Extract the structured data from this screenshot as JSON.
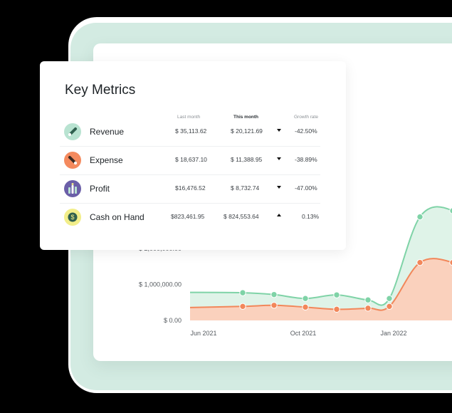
{
  "metrics": {
    "title": "Key Metrics",
    "columns": {
      "last_month": "Last month",
      "this_month": "This month",
      "growth": "Growth rate"
    },
    "rows": [
      {
        "label": "Revenue",
        "last": "$ 35,113.62",
        "this": "$ 20,121.69",
        "direction": "down",
        "growth": "-42.50%",
        "icon": "revenue-icon",
        "icon_color": "#b8e3d1"
      },
      {
        "label": "Expense",
        "last": "$ 18,637.10",
        "this": "$ 11,388.95",
        "direction": "down",
        "growth": "-38.89%",
        "icon": "expense-icon",
        "icon_color": "#f48a5e"
      },
      {
        "label": "Profit",
        "last": "$16,476.52",
        "this": "$ 8,732.74",
        "direction": "down",
        "growth": "-47.00%",
        "icon": "profit-icon",
        "icon_color": "#6b5fa8"
      },
      {
        "label": "Cash on Hand",
        "last": "$823,461.95",
        "this": "$ 824,553.64",
        "direction": "up",
        "growth": "0.13%",
        "icon": "cash-icon",
        "icon_color": "#f2ee8a"
      }
    ]
  },
  "chart_data": {
    "type": "area",
    "y_ticks": [
      "$ 0.00",
      "$ 1,000,000.00",
      "$ 2,000,000.00"
    ],
    "ylim": [
      0,
      3000000
    ],
    "x_ticks": [
      "Jun 2021",
      "Oct 2021",
      "Jan 2022"
    ],
    "x": [
      0,
      1,
      2,
      3,
      4,
      5,
      6,
      7,
      8,
      9
    ],
    "series": [
      {
        "color": "#7fd3a7",
        "fill": "#dff3e8",
        "values": [
          780000,
          770000,
          720000,
          610000,
          710000,
          570000,
          610000,
          2880000,
          3050000,
          2200000
        ]
      },
      {
        "color": "#f2875a",
        "fill": "#fad1bd",
        "values": [
          360000,
          390000,
          420000,
          370000,
          310000,
          340000,
          390000,
          1610000,
          1610000,
          1140000
        ]
      }
    ],
    "colors": {
      "green_line": "#7fd3a7",
      "orange_line": "#f2875a"
    }
  }
}
